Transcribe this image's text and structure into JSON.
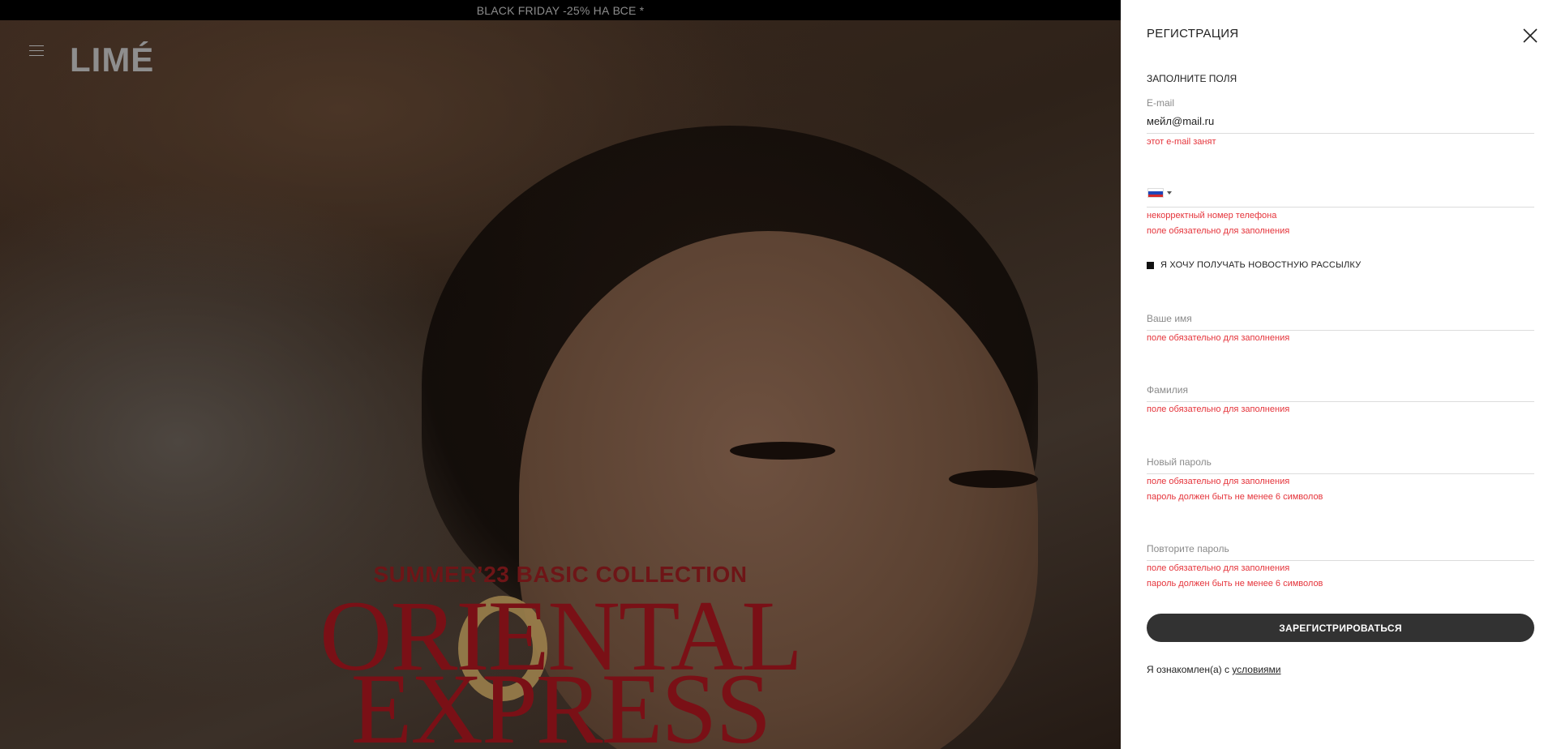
{
  "promo": {
    "text": "BLACK FRIDAY -25% НА ВСЕ *"
  },
  "header": {
    "logo": "LIMÉ"
  },
  "hero": {
    "subtitle": "SUMMER’23 BASIC COLLECTION",
    "title_line1": "ORIENTAL",
    "title_line2": "EXPRESS"
  },
  "panel": {
    "title": "РЕГИСТРАЦИЯ",
    "subhead": "ЗАПОЛНИТЕ ПОЛЯ",
    "email": {
      "label": "E-mail",
      "value": "мейл@mail.ru",
      "error": "этот e-mail занят"
    },
    "phone": {
      "country": "Russia",
      "errors": [
        "некорректный номер телефона",
        "поле обязательно для заполнения"
      ]
    },
    "newsletter": {
      "label": "Я ХОЧУ ПОЛУЧАТЬ НОВОСТНУЮ РАССЫЛКУ",
      "checked": true
    },
    "first_name": {
      "label": "Ваше имя",
      "error": "поле обязательно для заполнения"
    },
    "last_name": {
      "label": "Фамилия",
      "error": "поле обязательно для заполнения"
    },
    "password": {
      "label": "Новый пароль",
      "errors": [
        "поле обязательно для заполнения",
        "пароль должен быть не менее 6 символов"
      ]
    },
    "password_repeat": {
      "label": "Повторите пароль",
      "errors": [
        "поле обязательно для заполнения",
        "пароль должен быть не менее 6 символов"
      ]
    },
    "submit_label": "ЗАРЕГИСТРИРОВАТЬСЯ",
    "terms_text": "Я ознакомлен(а) с ",
    "terms_link": "условиями"
  },
  "colors": {
    "error": "#e5343b",
    "button": "#323232",
    "hero_text": "#7a1016"
  },
  "icons": [
    "menu-icon",
    "close-icon",
    "russia-flag-icon",
    "caret-down-icon"
  ]
}
